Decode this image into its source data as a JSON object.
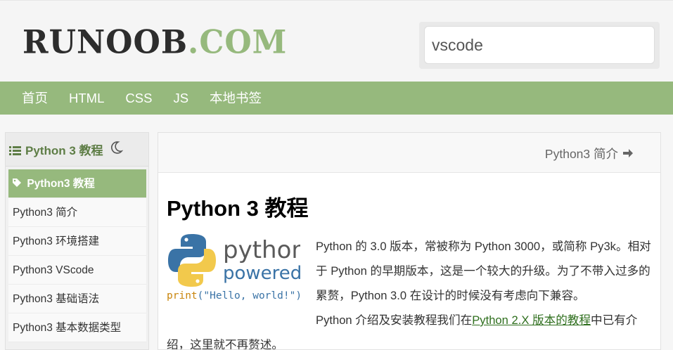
{
  "header": {
    "logo_dark": "RUNOOB",
    "logo_green": ".COM",
    "search_value": "vscode"
  },
  "nav": {
    "items": [
      "首页",
      "HTML",
      "CSS",
      "JS",
      "本地书签"
    ]
  },
  "sidebar": {
    "title": "Python 3 教程",
    "items": [
      "Python3 教程",
      "Python3 简介",
      "Python3 环境搭建",
      "Python3 VScode",
      "Python3 基础语法",
      "Python3 基本数据类型"
    ]
  },
  "main": {
    "next_label": "Python3 简介",
    "title": "Python 3 教程",
    "logo_word1": "python",
    "logo_word2": "powered",
    "logo_code_fn": "print",
    "logo_code_arg": "(\"Hello, world!\")",
    "para1": "Python 的 3.0 版本，常被称为 Python 3000，或简称 Py3k。相对于 Python 的早期版本，这是一个较大的升级。为了不带入过多的累赘，Python 3.0 在设计的时候没有考虑向下兼容。",
    "para2_pre": "Python 介绍及安装教程我们在",
    "para2_link": "Python 2.X 版本的教程",
    "para2_post": "中已有介绍，这里就不再赘述。"
  },
  "colors": {
    "brand_green": "#96b97d",
    "dark": "#2d2d2d",
    "link": "#2f6f1e"
  }
}
